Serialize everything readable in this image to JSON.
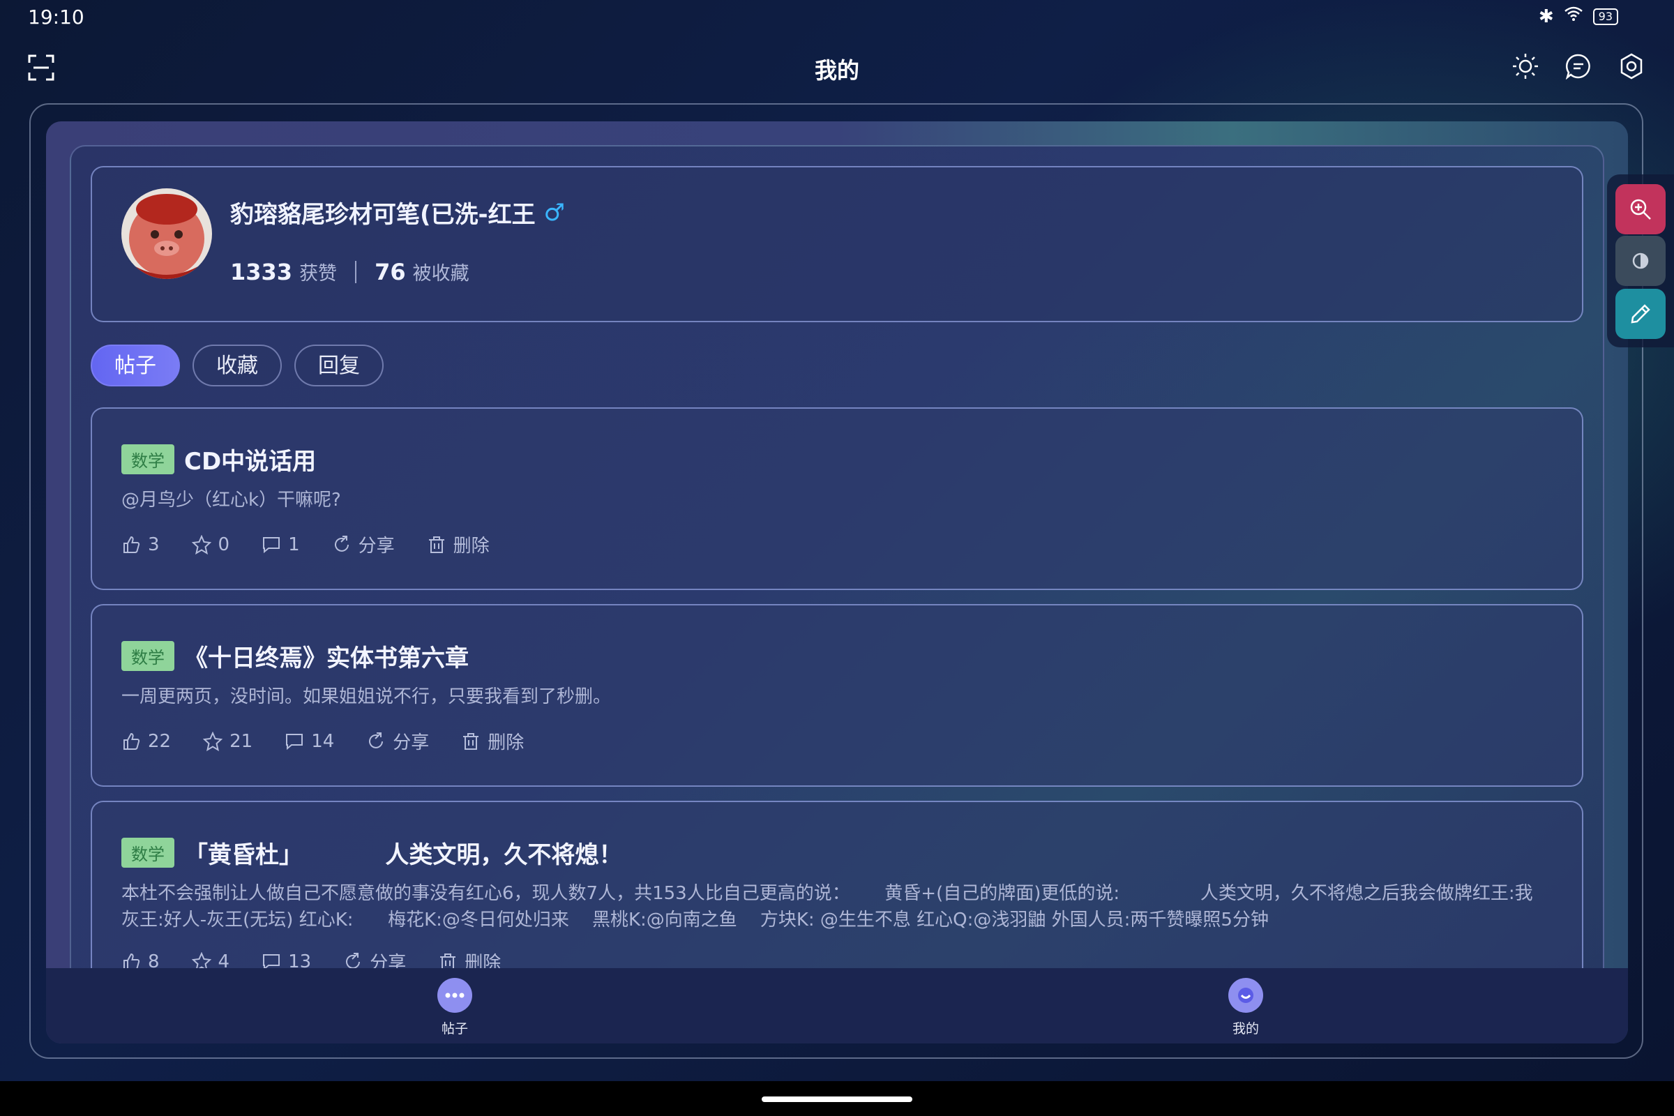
{
  "status_bar": {
    "time": "19:10",
    "battery": "93"
  },
  "header": {
    "title": "我的"
  },
  "profile": {
    "name": "豹瑢貉尾珍材可笔(已洗-红王",
    "gender_symbol": "♂",
    "likes_count": "1333",
    "likes_label": "获赞",
    "favorited_count": "76",
    "favorited_label": "被收藏"
  },
  "tabs": [
    {
      "label": "帖子",
      "active": true
    },
    {
      "label": "收藏",
      "active": false
    },
    {
      "label": "回复",
      "active": false
    }
  ],
  "posts": [
    {
      "tag": "数学",
      "title": "CD中说话用",
      "body": "@月鸟少（红心k）干嘛呢?",
      "likes": "3",
      "stars": "0",
      "comments": "1",
      "share_label": "分享",
      "delete_label": "删除"
    },
    {
      "tag": "数学",
      "title": "《十日终焉》实体书第六章",
      "body": "一周更两页，没时间。如果姐姐说不行，只要我看到了秒删。",
      "likes": "22",
      "stars": "21",
      "comments": "14",
      "share_label": "分享",
      "delete_label": "删除"
    },
    {
      "tag": "数学",
      "title": "「黄昏杜」          人类文明，久不将熄！",
      "body": "本杜不会强制让人做自己不愿意做的事没有红心6，现人数7人，共153人比自己更高的说：      黄昏+(自己的牌面)更低的说:              人类文明，久不将熄之后我会做牌红王:我灰王:好人-灰王(无坛) 红心K:      梅花K:@冬日何处归来    黑桃K:@向南之鱼    方块K: @生生不息 红心Q:@浅羽鼬 外国人员:两千赞曝照5分钟",
      "likes": "8",
      "stars": "4",
      "comments": "13",
      "share_label": "分享",
      "delete_label": "删除"
    }
  ],
  "bottom_nav": [
    {
      "label": "帖子",
      "icon": "chat-bubble-icon"
    },
    {
      "label": "我的",
      "icon": "profile-icon"
    }
  ],
  "side_tools": [
    {
      "icon": "zoom-in-icon",
      "color": "#c2335c"
    },
    {
      "icon": "contrast-icon",
      "color": "#3b4b5c"
    },
    {
      "icon": "pen-icon",
      "color": "#1e8fa0"
    }
  ],
  "colors": {
    "accent": "#6366f1",
    "tag_bg": "#8fd49a",
    "tag_text": "#2e7d45",
    "gender": "#3ab6ff"
  }
}
